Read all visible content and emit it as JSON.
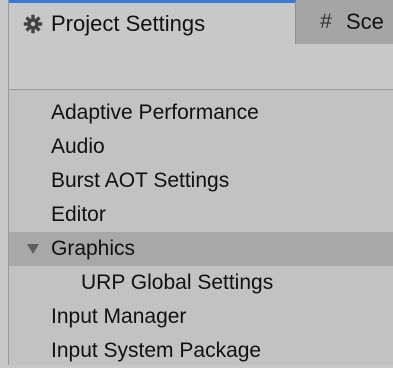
{
  "tabs": [
    {
      "label": "Project Settings",
      "icon": "gear-icon",
      "active": true
    },
    {
      "label": "Sce",
      "icon": "hash-icon",
      "active": false
    }
  ],
  "settings_list": {
    "items": [
      {
        "label": "Adaptive Performance",
        "level": 0
      },
      {
        "label": "Audio",
        "level": 0
      },
      {
        "label": "Burst AOT Settings",
        "level": 0
      },
      {
        "label": "Editor",
        "level": 0
      },
      {
        "label": "Graphics",
        "level": 0,
        "expanded": true,
        "selected": true
      },
      {
        "label": "URP Global Settings",
        "level": 1
      },
      {
        "label": "Input Manager",
        "level": 0
      },
      {
        "label": "Input System Package",
        "level": 0
      }
    ]
  },
  "colors": {
    "active_tab_accent": "#3a79d8",
    "selected_row": "#a8a8a8"
  }
}
